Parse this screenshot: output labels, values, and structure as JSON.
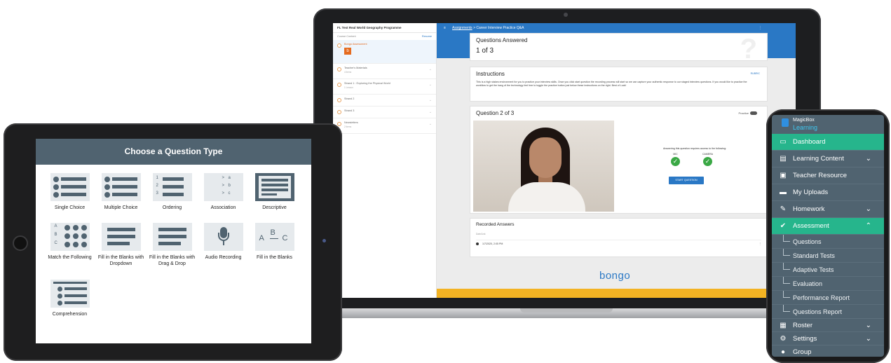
{
  "laptop": {
    "sidebar": {
      "course_title": "FL Test Real World Geography Programme",
      "course_content_label": "Course Content",
      "resume_label": "Resume",
      "items": [
        {
          "title": "Bongo Assessment",
          "meta": ""
        },
        {
          "title": "Teacher's Materials",
          "meta": "4 items",
          "chevron": "⌄"
        },
        {
          "title": "Strand 1 : Exploring the Physical World",
          "meta": "1 Lesson",
          "chevron": "⌄"
        },
        {
          "title": "Strand 2",
          "meta": "",
          "chevron": "⌄"
        },
        {
          "title": "Strand 3",
          "meta": "",
          "chevron": "⌄"
        },
        {
          "title": "Newsletters",
          "meta": "2 items",
          "chevron": "⌄"
        }
      ]
    },
    "topbar": {
      "menu_icon": "≡",
      "crumb_link": "Assignments",
      "separator": ">",
      "crumb_current": "Career Interview Practice  Q&A",
      "more_icon": "⋮"
    },
    "questions_answered": {
      "label": "Questions Answered",
      "value": "1 of 3",
      "watermark": "?"
    },
    "instructions": {
      "heading": "Instructions",
      "rubric": "RUBRIC",
      "text": "This is a high stakes environment for you to practice your interview skills. Once you click start question the recording process will start so we can capture your authentic response to our staged interview questions. If you would like to practice the workflow to get the hang of the technology feel free to toggle the practice button just below these instructions on the right. Best of Luck!"
    },
    "question": {
      "heading": "Question 2 of 3",
      "practice_label": "Practice",
      "access_text": "Answering this question requires access to the following:",
      "mic_label": "MIC",
      "camera_label": "CAMERA",
      "check_icon": "✓",
      "start_button": "START QUESTION"
    },
    "recorded": {
      "heading": "Recorded Answers",
      "column": "Date/Link",
      "row": "1/7/2020, 2:05 PM",
      "row_more": "⋮"
    },
    "footer_brand": "bongo",
    "colors": {
      "accent": "#2a78c5",
      "footer_stripe": "#f3b323"
    }
  },
  "tablet": {
    "header": "Choose a Question Type",
    "types": [
      {
        "label": "Single Choice",
        "icon": "single-choice-icon"
      },
      {
        "label": "Multiple Choice",
        "icon": "multiple-choice-icon"
      },
      {
        "label": "Ordering",
        "icon": "ordering-icon"
      },
      {
        "label": "Association",
        "icon": "association-icon"
      },
      {
        "label": "Descriptive",
        "icon": "descriptive-icon"
      },
      {
        "label": "Match the Following",
        "icon": "match-icon"
      },
      {
        "label": "Fill in the Blanks with Dropdown",
        "icon": "dropdown-blank-icon"
      },
      {
        "label": "Fill in the Blanks with Drag & Drop",
        "icon": "drag-drop-blank-icon"
      },
      {
        "label": "Audio Recording",
        "icon": "microphone-icon"
      },
      {
        "label": "Fill in the Blanks",
        "icon": "abc-blank-icon"
      },
      {
        "label": "Comprehension",
        "icon": "comprehension-icon"
      }
    ],
    "ordering_digits": [
      "1",
      "2",
      "3"
    ],
    "association_letters": [
      "a",
      "b",
      "c"
    ],
    "arrow": ">",
    "match_letters": [
      "A",
      "B",
      "C"
    ],
    "abc_letters": [
      "A",
      "B",
      "C"
    ],
    "colors": {
      "header": "#506370",
      "tile": "#e6eaed"
    }
  },
  "phone": {
    "brand_line1": "MagicBox",
    "brand_line2": "Learning",
    "chev_down": "⌄",
    "chev_up": "⌃",
    "menu": {
      "dashboard": "Dashboard",
      "learning_content": "Learning Content",
      "teacher_resource": "Teacher Resource",
      "my_uploads": "My Uploads",
      "homework": "Homework",
      "assessment": "Assessment",
      "questions": "Questions",
      "standard_tests": "Standard Tests",
      "adaptive_tests": "Adaptive Tests",
      "evaluation": "Evaluation",
      "performance_report": "Performance Report",
      "questions_report": "Questions Report",
      "roster": "Roster",
      "settings": "Settings",
      "group": "Group"
    },
    "colors": {
      "menu_bg": "#506370",
      "active": "#26b58c"
    }
  }
}
